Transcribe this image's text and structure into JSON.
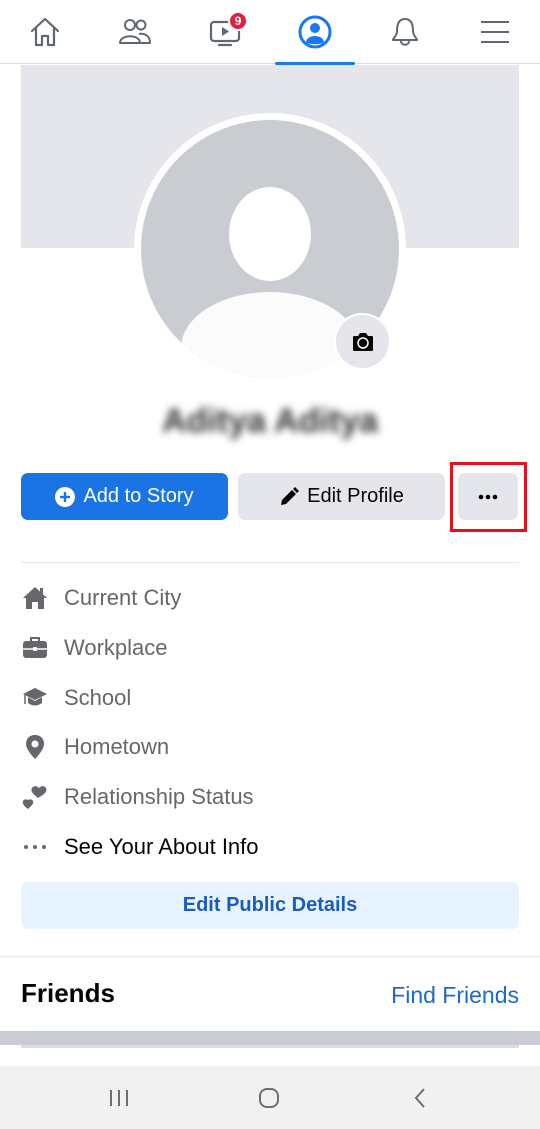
{
  "top_nav": {
    "items": [
      {
        "name": "home",
        "icon": "home-icon",
        "active": false
      },
      {
        "name": "friends",
        "icon": "friends-icon",
        "active": false
      },
      {
        "name": "watch",
        "icon": "watch-icon",
        "active": false,
        "badge": "9"
      },
      {
        "name": "profile",
        "icon": "profile-icon",
        "active": true
      },
      {
        "name": "notifications",
        "icon": "bell-icon",
        "active": false
      },
      {
        "name": "menu",
        "icon": "hamburger-menu-icon",
        "active": false
      }
    ],
    "accent_color": "#1877f2",
    "badge_color": "#e41e3f"
  },
  "profile": {
    "name": "Aditya Aditya",
    "name_blurred": true,
    "camera_icon": "camera-icon"
  },
  "actions": {
    "add_to_story": "Add to Story",
    "edit_profile": "Edit Profile",
    "more": "•••"
  },
  "details": [
    {
      "icon": "house-icon",
      "label": "Current City"
    },
    {
      "icon": "briefcase-icon",
      "label": "Workplace"
    },
    {
      "icon": "graduation-cap-icon",
      "label": "School"
    },
    {
      "icon": "location-pin-icon",
      "label": "Hometown"
    },
    {
      "icon": "hearts-icon",
      "label": "Relationship Status"
    },
    {
      "icon": "more-dots-icon",
      "label": "See Your About Info"
    }
  ],
  "edit_public_details": "Edit Public Details",
  "friends": {
    "title": "Friends",
    "find_friends": "Find Friends"
  },
  "system_nav": {
    "recents": "recents-icon",
    "home": "home-circle-icon",
    "back": "back-chevron-icon"
  }
}
